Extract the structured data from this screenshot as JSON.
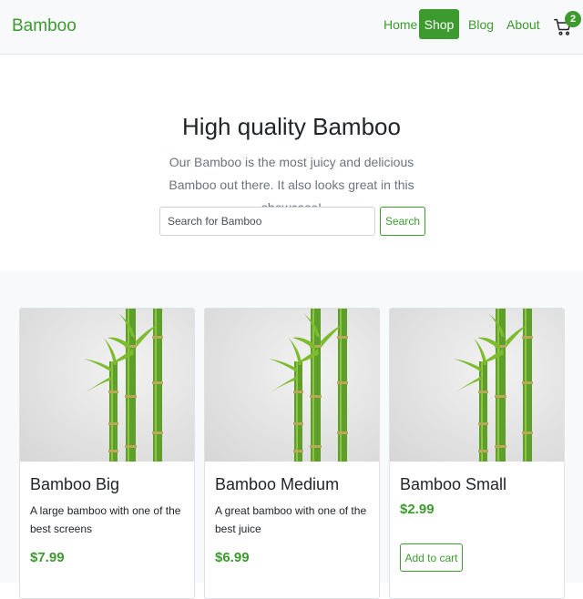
{
  "navbar": {
    "brand": "Bamboo",
    "links": [
      {
        "label": "Home"
      },
      {
        "label": "Shop",
        "active": true
      },
      {
        "label": "Blog"
      },
      {
        "label": "About"
      }
    ],
    "cart": {
      "count": "2",
      "icon": "cart-icon"
    }
  },
  "hero": {
    "title": "High quality Bamboo",
    "text": "Our Bamboo is the most juicy and delicious Bamboo out there. It also looks great in this showcase!",
    "search": {
      "placeholder": "Search for Bamboo",
      "value": "",
      "button_label": "Search"
    }
  },
  "products": [
    {
      "name": "Bamboo Big",
      "description": "A large bamboo with one of the best screens",
      "price": "$7.99"
    },
    {
      "name": "Bamboo Medium",
      "description": "A great bamboo with one of the best juice",
      "price": "$6.99"
    },
    {
      "name": "Bamboo Small",
      "description": "",
      "price": "$2.99",
      "button_label": "Add to cart"
    }
  ],
  "colors": {
    "accent": "#3d9a2f",
    "navbar_bg": "#f8f9fa",
    "text": "#212529",
    "muted": "#6c757d"
  }
}
